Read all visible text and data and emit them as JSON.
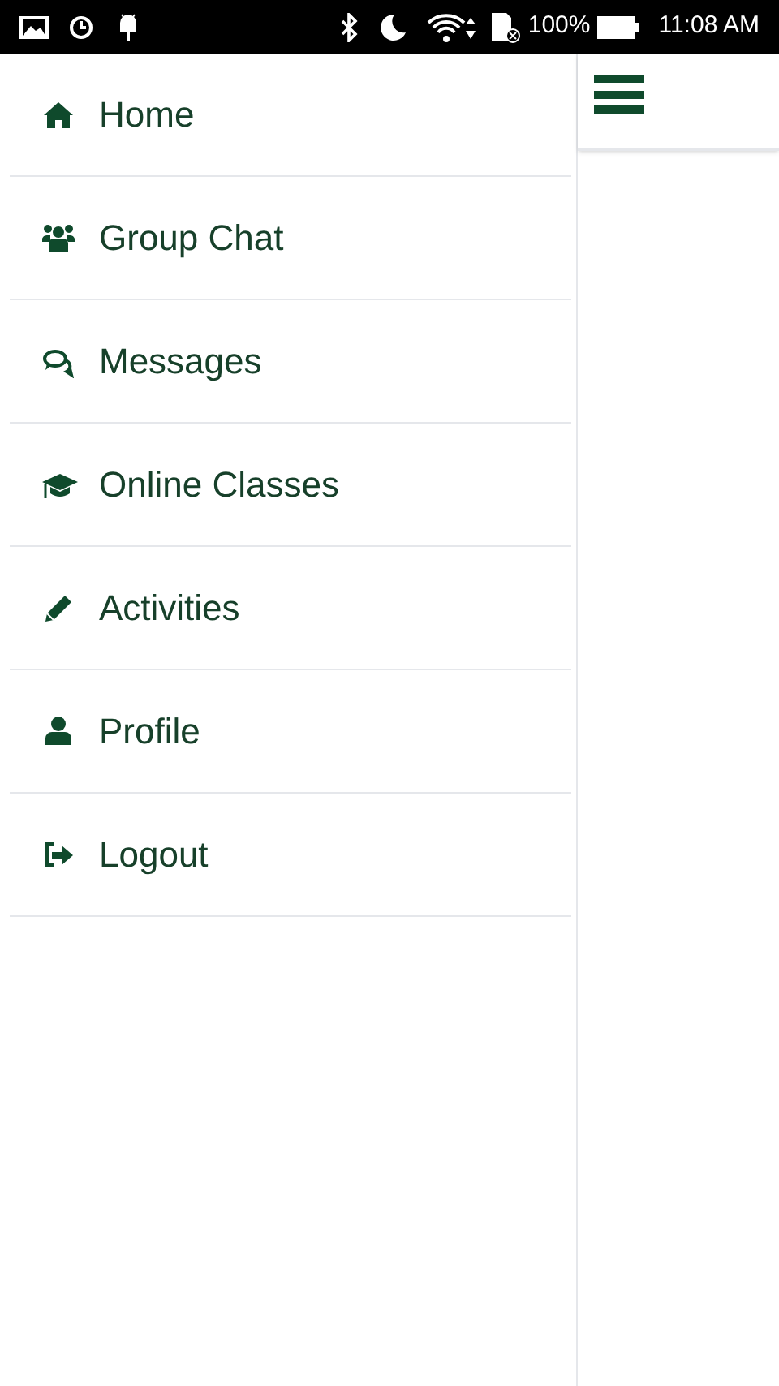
{
  "status_bar": {
    "battery": "100%",
    "time": "11:08 AM"
  },
  "menu": {
    "items": [
      {
        "label": "Home"
      },
      {
        "label": "Group Chat"
      },
      {
        "label": "Messages"
      },
      {
        "label": "Online Classes"
      },
      {
        "label": "Activities"
      },
      {
        "label": "Profile"
      },
      {
        "label": "Logout"
      }
    ]
  }
}
